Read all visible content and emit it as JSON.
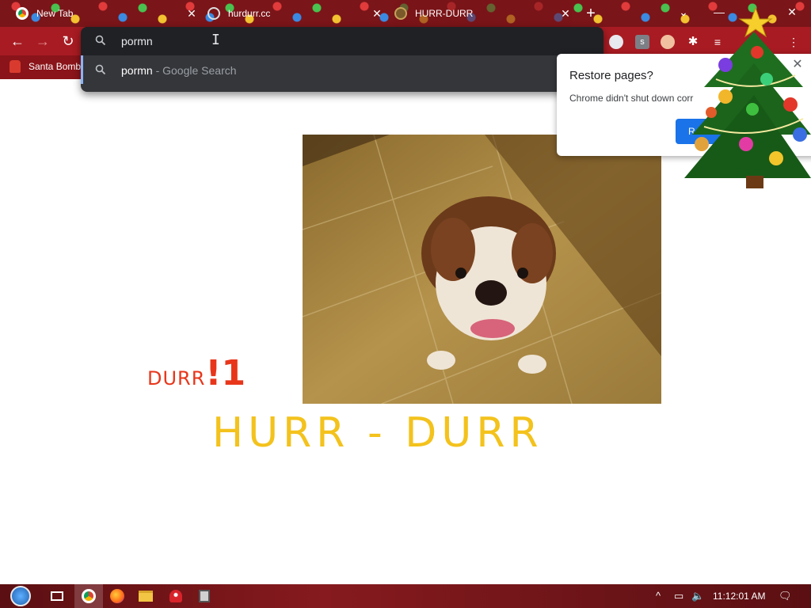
{
  "tabs": [
    {
      "title": "New Tab",
      "favicon": "chrome-icon",
      "close": "✕"
    },
    {
      "title": "hurdurr.cc",
      "favicon": "globe-loading-icon",
      "close": "✕"
    },
    {
      "title": "HURR-DURR",
      "favicon": "hurr-durr-favicon",
      "close": "✕",
      "active": true
    }
  ],
  "window_controls": {
    "tab_search": "⌄",
    "minimize": "—",
    "restore": "☐",
    "close": "✕"
  },
  "toolbar": {
    "back": "←",
    "forward": "→",
    "reload": "↻"
  },
  "omnibox": {
    "value": "pormn",
    "suggestion": {
      "query": "pormn",
      "suffix": " - Google Search"
    }
  },
  "bookmarks": [
    {
      "label": "Santa Bomb",
      "icon": "santa-icon"
    }
  ],
  "restore_bubble": {
    "title": "Restore pages?",
    "body": "Chrome didn't shut down corr",
    "button": "Re",
    "close": "✕"
  },
  "page": {
    "caption_word": "DURR",
    "caption_bang": "!1",
    "headline": "HURR - DURR",
    "colors": {
      "caption": "#e8361b",
      "headline": "#f3c21c"
    }
  },
  "taskbar": {
    "time": "11:12:01 AM",
    "apps": [
      "start-orb-icon",
      "task-view-icon",
      "chrome-icon",
      "firefox-icon",
      "file-explorer-icon",
      "mushroom-app-icon",
      "usb-device-icon"
    ],
    "tray": {
      "chevron": "^",
      "notification": "🗨"
    }
  }
}
